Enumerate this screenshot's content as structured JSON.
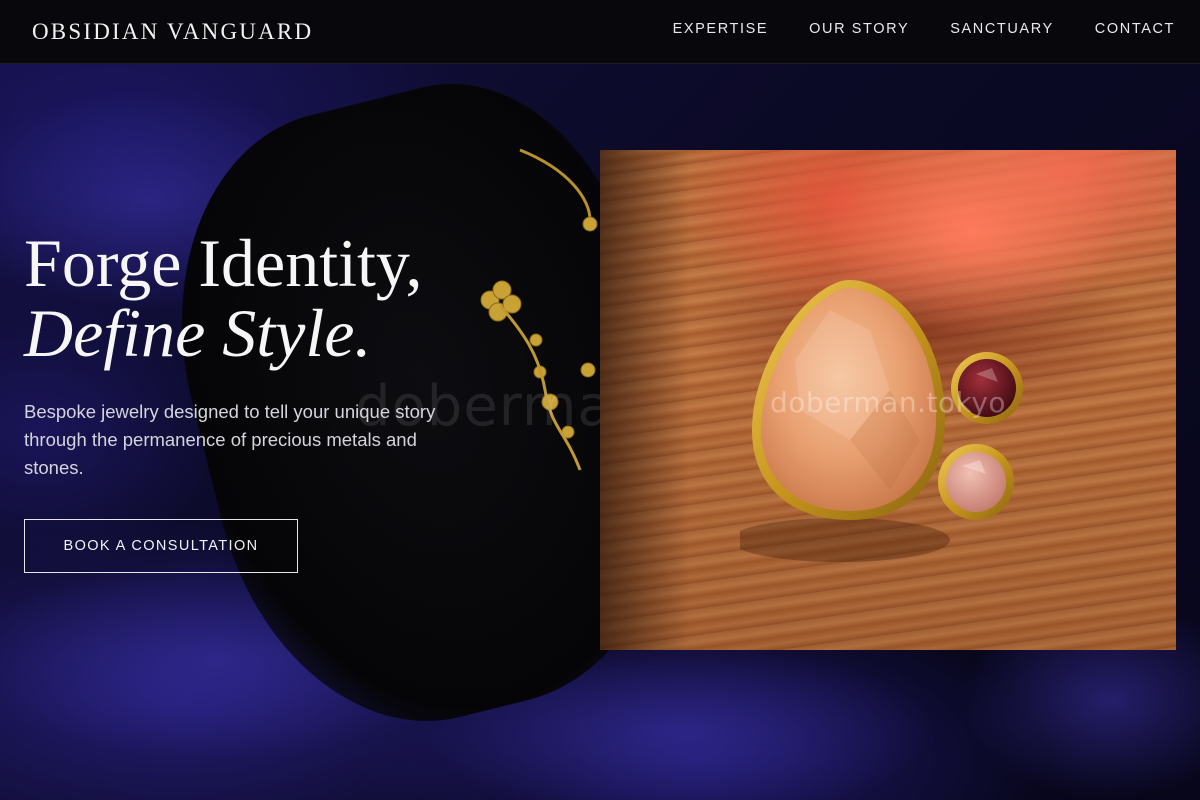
{
  "brand": {
    "name": "OBSIDIAN VANGUARD"
  },
  "nav": {
    "items": [
      {
        "label": "EXPERTISE"
      },
      {
        "label": "OUR STORY"
      },
      {
        "label": "SANCTUARY"
      },
      {
        "label": "CONTACT"
      }
    ]
  },
  "hero": {
    "title_line1": "Forge Identity,",
    "title_line2": "Define Style.",
    "subtitle": "Bespoke jewelry designed to tell your unique story through the permanence of precious metals and stones.",
    "cta_label": "BOOK A CONSULTATION"
  },
  "images": {
    "background_watermark": "doberma",
    "product_watermark": "doberman.tokyo"
  },
  "colors": {
    "header_bg": "#07070c",
    "velvet": "#1b1660",
    "text": "#f6f6f6",
    "gold": "#d4a52a",
    "stone_peach": "#e9a071",
    "stone_garnet": "#5a1020",
    "stone_pink": "#e2a092"
  }
}
